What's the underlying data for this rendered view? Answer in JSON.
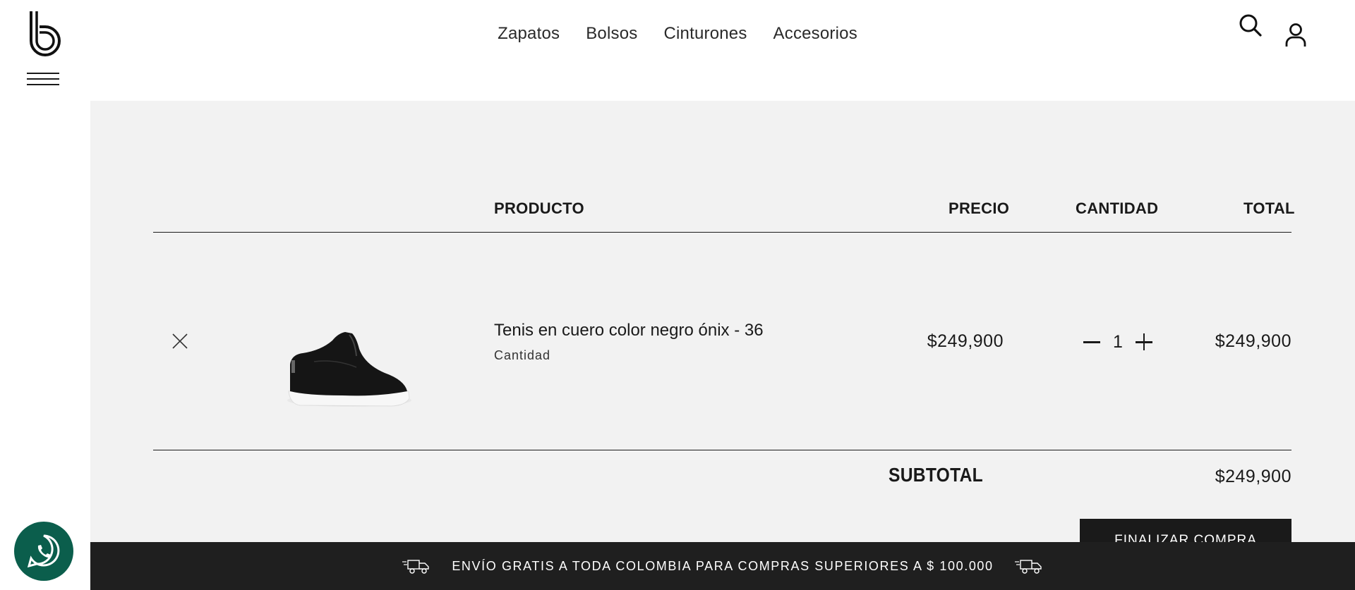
{
  "nav": {
    "items": [
      "Zapatos",
      "Bolsos",
      "Cinturones",
      "Accesorios"
    ]
  },
  "cart": {
    "headers": {
      "product": "PRODUCTO",
      "price": "PRECIO",
      "quantity": "CANTIDAD",
      "total": "TOTAL"
    },
    "items": [
      {
        "name": "Tenis en cuero color negro ónix - 36",
        "quantity_label": "Cantidad",
        "price": "$249,900",
        "quantity": "1",
        "total": "$249,900"
      }
    ],
    "subtotal_label": "SUBTOTAL",
    "subtotal": "$249,900",
    "checkout_label": "FINALIZAR COMPRA"
  },
  "banner": {
    "text": "ENVÍO GRATIS A TODA COLOMBIA PARA COMPRAS SUPERIORES A $ 100.000"
  },
  "icons": {
    "logo": "b-logo",
    "menu": "hamburger-icon",
    "search": "search-icon",
    "account": "user-icon",
    "remove": "close-icon",
    "whatsapp": "whatsapp-icon",
    "shipping": "truck-icon"
  },
  "colors": {
    "panel": "#f2f2f2",
    "dark": "#1f1f1f",
    "whatsapp": "#0b5e4c"
  }
}
